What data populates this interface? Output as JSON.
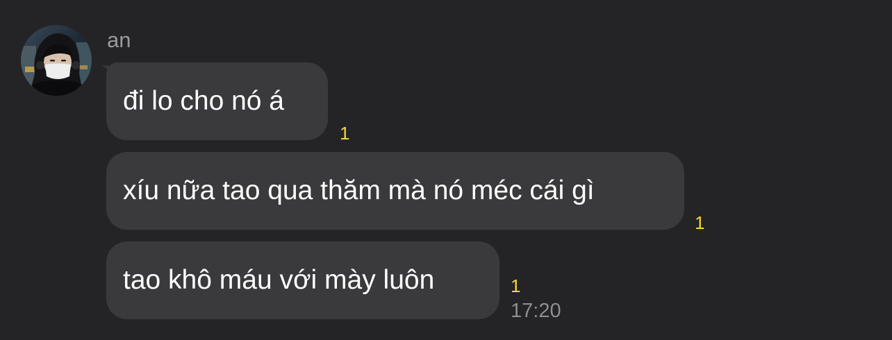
{
  "sender": {
    "name": "an",
    "avatar_icon": "user-avatar-photo"
  },
  "messages": [
    {
      "text": "đi lo cho nó á",
      "read_count": "1"
    },
    {
      "text": "xíu nữa tao qua thăm mà nó méc cái gì",
      "read_count": "1"
    },
    {
      "text": "tao khô máu với mày luôn",
      "read_count": "1"
    }
  ],
  "last_message_time": "17:20",
  "colors": {
    "background": "#242426",
    "bubble": "#3a3a3c",
    "message_text": "#ffffff",
    "read_count": "#f5d73a",
    "timestamp": "#8e8e93",
    "sender_name": "#9a9a9e"
  }
}
